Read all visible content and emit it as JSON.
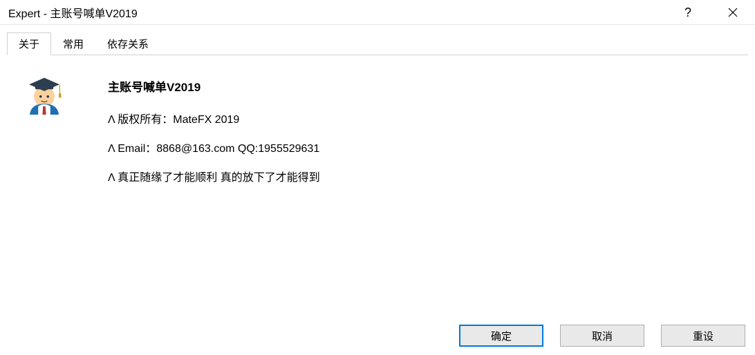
{
  "window": {
    "title": "Expert - 主账号喊单V2019"
  },
  "tabs": {
    "items": [
      {
        "label": "关于"
      },
      {
        "label": "常用"
      },
      {
        "label": "依存关系"
      }
    ]
  },
  "about": {
    "heading": "主账号喊单V2019",
    "line1": "Λ 版权所有：MateFX 2019",
    "line2": "Λ Email：8868@163.com  QQ:1955529631",
    "line3": "Λ 真正随缘了才能顺利  真的放下了才能得到"
  },
  "buttons": {
    "ok": "确定",
    "cancel": "取消",
    "reset": "重设"
  }
}
